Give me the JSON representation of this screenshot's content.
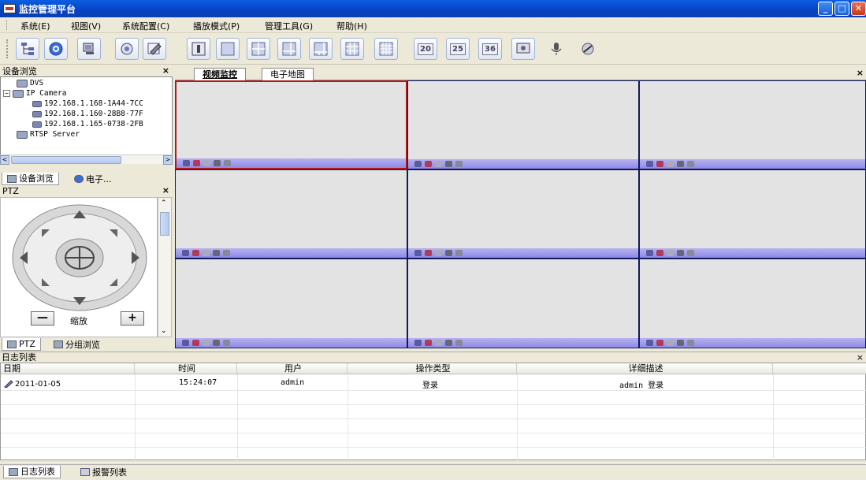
{
  "window": {
    "title": "监控管理平台",
    "minimize": "_",
    "maximize": "□",
    "close": "✕"
  },
  "menu": [
    "系统(E)",
    "视图(V)",
    "系统配置(C)",
    "播放模式(P)",
    "管理工具(G)",
    "帮助(H)"
  ],
  "toolbar": {
    "buttons": [
      "device-tree-icon",
      "globe-icon",
      "monitor-icon",
      "ptz-icon",
      "edit-icon",
      "layout-1-icon",
      "layout-blank-icon",
      "layout-4-icon",
      "layout-6-icon",
      "layout-8-icon",
      "layout-9-icon",
      "layout-16-icon"
    ],
    "numbered": [
      "20",
      "25",
      "36"
    ],
    "extra": [
      "screenshot-icon",
      "microphone-icon",
      "tools-icon"
    ]
  },
  "device_panel": {
    "title": "设备浏览",
    "close": "×",
    "tree": [
      {
        "label": "DVS",
        "level": 0
      },
      {
        "label": "IP Camera",
        "level": 0,
        "expand": "−"
      },
      {
        "label": "192.168.1.168-1A44-7CC",
        "level": 1
      },
      {
        "label": "192.168.1.160-28B8-77F",
        "level": 1
      },
      {
        "label": "192.168.1.165-0738-2FB",
        "level": 1
      },
      {
        "label": "RTSP Server",
        "level": 0
      }
    ],
    "tabs": [
      "设备浏览",
      "电子..."
    ]
  },
  "ptz_panel": {
    "title": "PTZ",
    "close": "×",
    "zoom_label": "缩放",
    "minus": "—",
    "plus": "+",
    "tabs": [
      "PTZ",
      "分组浏览"
    ]
  },
  "video": {
    "tabs": [
      "视频监控",
      "电子地图"
    ],
    "close": "×"
  },
  "log": {
    "title": "日志列表",
    "close": "×",
    "columns": [
      "日期",
      "时间",
      "用户",
      "操作类型",
      "详细描述"
    ],
    "rows": [
      [
        "2011-01-05",
        "15:24:07",
        "admin",
        "登录",
        "admin 登录"
      ]
    ],
    "tabs": [
      "日志列表",
      "报警列表"
    ]
  },
  "colors": {
    "accent": "#0a5fe0",
    "selected_cell": "#b01919",
    "cell_bar": "#8f89e6"
  }
}
